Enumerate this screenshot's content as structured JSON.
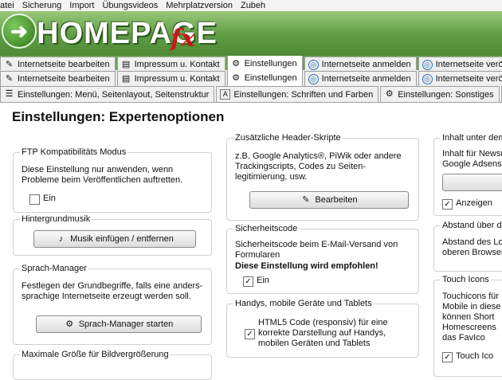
{
  "menu": [
    "atei",
    "Sicherung",
    "Import",
    "Übungsvideos",
    "Mehrplatzversion",
    "Zubeh"
  ],
  "logo": {
    "text": "HOMEPAGE",
    "suffix": "fx"
  },
  "tabs_row1": [
    {
      "label": "Internetseite bearbeiten",
      "icon": "doc-edit-icon"
    },
    {
      "label": "Impressum u. Kontakt",
      "icon": "doc-icon"
    },
    {
      "label": "Einstellungen",
      "icon": "gear-icon",
      "active": true
    },
    {
      "label": "Internetseite anmelden",
      "icon": "globe-icon"
    },
    {
      "label": "Internetseite veröff",
      "icon": "globe-icon"
    }
  ],
  "tabs_row2": [
    {
      "label": "Internetseite bearbeiten",
      "icon": "doc-edit-icon"
    },
    {
      "label": "Impressum u. Kontakt",
      "icon": "doc-icon"
    },
    {
      "label": "Einstellungen",
      "icon": "gear-icon",
      "active": true
    },
    {
      "label": "Internetseite anmelden",
      "icon": "globe-icon"
    },
    {
      "label": "Internetseite veröffen",
      "icon": "globe-icon"
    }
  ],
  "tabs_row3": [
    {
      "label": "Einstellungen: Menü, Seitenlayout, Seitenstruktur",
      "icon": "list-icon"
    },
    {
      "label": "Einstellungen: Schriften und Farben",
      "icon": "font-icon"
    },
    {
      "label": "Einstellungen: Sonstiges",
      "icon": "gear-icon"
    },
    {
      "label": "Ei",
      "icon": "gear-icon"
    }
  ],
  "page_title": "Einstellungen: Expertenoptionen",
  "col1": {
    "ftp": {
      "legend": "FTP Kompatibilitäts Modus",
      "desc1": "Diese Einstellung nur anwenden, wenn",
      "desc2": "Probleme beim Veröffentlichen auftretten.",
      "checkbox": "Ein",
      "checked": false
    },
    "music": {
      "legend": "Hintergrundmusik",
      "button": "Musik einfügen / entfernen"
    },
    "lang": {
      "legend": "Sprach-Manager",
      "desc1": "Festlegen der Grundbegriffe, falls eine anders-",
      "desc2": "sprachige Internetseite erzeugt werden soll.",
      "button": "Sprach-Manager starten"
    },
    "maxsize": {
      "legend": "Maximale Größe für Bildvergrößerung"
    }
  },
  "col2": {
    "header": {
      "legend": "Zusätzliche Header-Skripte",
      "desc1": "z.B. Google Analytics®, PiWik oder andere",
      "desc2": "Trackingscripts, Codes zu Seiten-",
      "desc3": "legitimierung, usw.",
      "button": "Bearbeiten"
    },
    "security": {
      "legend": "Sicherheitscode",
      "desc1": "Sicherheitscode beim E-Mail-Versand von",
      "desc2": "Formularen",
      "desc3": "Diese Einstellung wird empfohlen!",
      "checkbox": "Ein",
      "checked": true
    },
    "mobile": {
      "legend": "Handys, mobile Geräte und Tablets",
      "line1": "HTML5 Code (responsiv) für eine",
      "line2": "korrekte Darstellung auf Handys,",
      "line3": "mobilen Geräten und Tablets",
      "checked": true
    }
  },
  "col3": {
    "inhalt": {
      "legend": "Inhalt unter dem M",
      "desc1": "Inhalt für Newsm",
      "desc2": "Google Adsense",
      "checkbox": "Anzeigen",
      "checked": true
    },
    "abstand": {
      "legend": "Abstand über der",
      "desc1": "Abstand des Lo",
      "desc2": "oberen Browser"
    },
    "touch": {
      "legend": "Touch Icons",
      "desc1": "Touchicons für",
      "desc2": "Mobile in diese",
      "desc3": "können Short",
      "desc4": "Homescreens",
      "desc5": "das FavIco",
      "checkbox": "Touch Ico",
      "checked": true
    }
  }
}
